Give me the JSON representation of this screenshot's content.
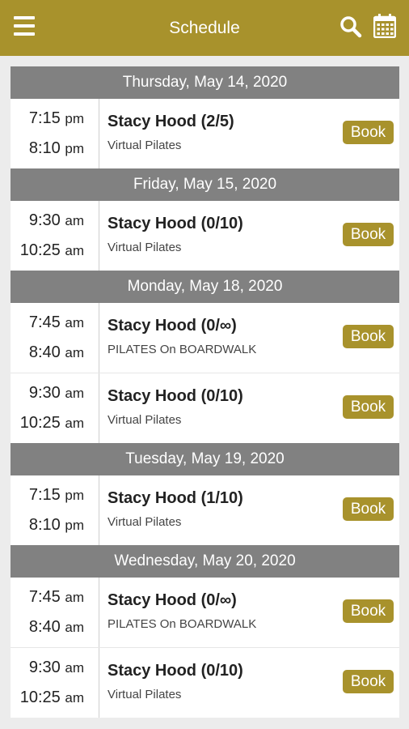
{
  "header": {
    "title": "Schedule",
    "menu_icon": "hamburger-menu-icon",
    "search_icon": "search-icon",
    "calendar_icon": "calendar-icon",
    "accent_color": "#a8922c"
  },
  "days": [
    {
      "date": "Thursday, May 14, 2020",
      "classes": [
        {
          "start": "7:15",
          "start_sfx": "pm",
          "end": "8:10",
          "end_sfx": "pm",
          "title": "Stacy Hood (2/5)",
          "location": "Virtual Pilates",
          "book": "Book"
        }
      ]
    },
    {
      "date": "Friday, May 15, 2020",
      "classes": [
        {
          "start": "9:30",
          "start_sfx": "am",
          "end": "10:25",
          "end_sfx": "am",
          "title": "Stacy Hood (0/10)",
          "location": "Virtual Pilates",
          "book": "Book"
        }
      ]
    },
    {
      "date": "Monday, May 18, 2020",
      "classes": [
        {
          "start": "7:45",
          "start_sfx": "am",
          "end": "8:40",
          "end_sfx": "am",
          "title": "Stacy Hood (0/∞)",
          "location": "PILATES On BOARDWALK",
          "book": "Book"
        },
        {
          "start": "9:30",
          "start_sfx": "am",
          "end": "10:25",
          "end_sfx": "am",
          "title": "Stacy Hood (0/10)",
          "location": "Virtual Pilates",
          "book": "Book"
        }
      ]
    },
    {
      "date": "Tuesday, May 19, 2020",
      "classes": [
        {
          "start": "7:15",
          "start_sfx": "pm",
          "end": "8:10",
          "end_sfx": "pm",
          "title": "Stacy Hood (1/10)",
          "location": "Virtual Pilates",
          "book": "Book"
        }
      ]
    },
    {
      "date": "Wednesday, May 20, 2020",
      "classes": [
        {
          "start": "7:45",
          "start_sfx": "am",
          "end": "8:40",
          "end_sfx": "am",
          "title": "Stacy Hood (0/∞)",
          "location": "PILATES On BOARDWALK",
          "book": "Book"
        },
        {
          "start": "9:30",
          "start_sfx": "am",
          "end": "10:25",
          "end_sfx": "am",
          "title": "Stacy Hood (0/10)",
          "location": "Virtual Pilates",
          "book": "Book"
        }
      ]
    }
  ]
}
